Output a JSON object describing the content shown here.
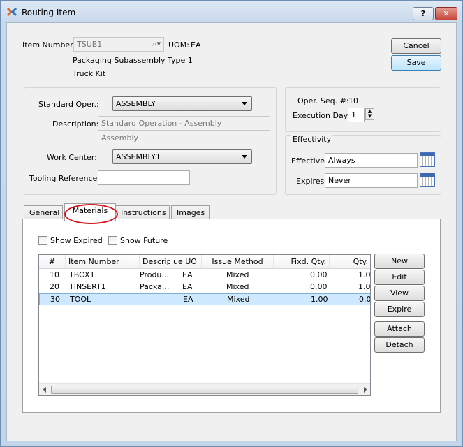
{
  "window": {
    "title": "Routing Item"
  },
  "titlebar": {
    "help": "?",
    "close": "✕"
  },
  "item": {
    "label": "Item Number:",
    "value": "TSUB1",
    "uom_label": "UOM:",
    "uom_value": "EA",
    "description1": "Packaging Subassembly Type 1",
    "description2": "Truck Kit"
  },
  "buttons": {
    "cancel": "Cancel",
    "save": "Save"
  },
  "operation": {
    "standard_label": "Standard Oper.:",
    "standard_value": "ASSEMBLY",
    "description_label": "Description:",
    "description_value": "Standard Operation - Assembly",
    "description_value2": "Assembly",
    "workcenter_label": "Work Center:",
    "workcenter_value": "ASSEMBLY1",
    "tooling_label": "Tooling Reference:"
  },
  "sequence": {
    "label": "Oper. Seq. #:",
    "value": "10",
    "execution_label": "Execution Day:",
    "execution_value": "1"
  },
  "effectivity": {
    "title": "Effectivity",
    "effective_label": "Effective",
    "effective_value": "Always",
    "expires_label": "Expires",
    "expires_value": "Never"
  },
  "tabs": [
    "General",
    "Materials",
    "Instructions",
    "Images"
  ],
  "materials": {
    "show_expired": "Show Expired",
    "show_future": "Show Future",
    "headers": [
      "#",
      "Item Number",
      "Descript",
      "ue UO",
      "Issue Method",
      "Fixd. Qty.",
      "Qty."
    ],
    "rows": [
      [
        "10",
        "TBOX1",
        "Produ...",
        "EA",
        "Mixed",
        "0.00",
        "1.0"
      ],
      [
        "20",
        "TINSERT1",
        "Packa...",
        "EA",
        "Mixed",
        "0.00",
        "1.0"
      ],
      [
        "30",
        "TOOL",
        "",
        "EA",
        "Mixed",
        "1.00",
        "0.0"
      ]
    ],
    "actions": [
      "New",
      "Edit",
      "View",
      "Expire",
      "Attach",
      "Detach"
    ]
  }
}
